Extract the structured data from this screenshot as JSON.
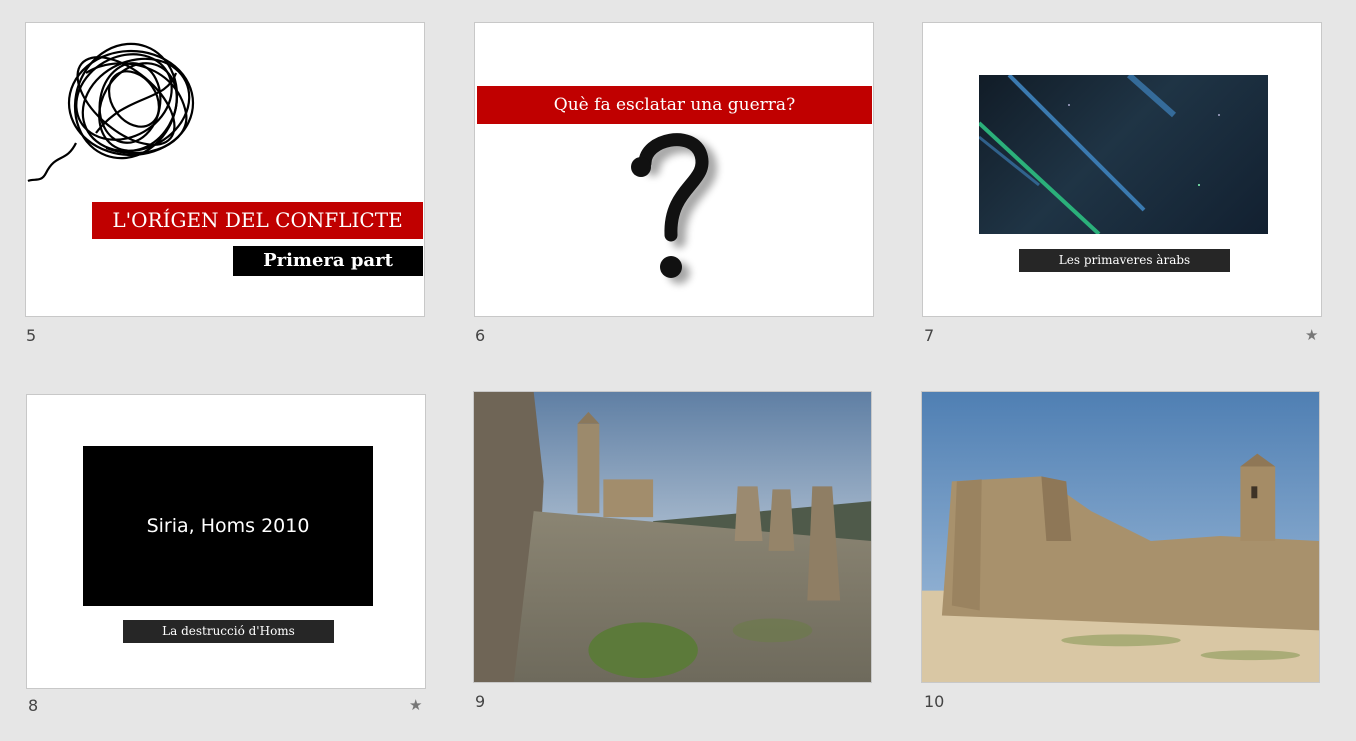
{
  "slides": [
    {
      "number": "5",
      "title": "L'ORÍGEN DEL CONFLICTE",
      "subtitle": "Primera part",
      "has_animation": false
    },
    {
      "number": "6",
      "title": "Què fa esclatar una guerra?",
      "has_animation": false
    },
    {
      "number": "7",
      "caption": "Les primaveres àrabs",
      "has_animation": true
    },
    {
      "number": "8",
      "video_text": "Siria, Homs 2010",
      "caption": "La destrucció d'Homs",
      "has_animation": true
    },
    {
      "number": "9",
      "has_animation": false
    },
    {
      "number": "10",
      "has_animation": false
    }
  ],
  "icons": {
    "animation_star": "★"
  },
  "colors": {
    "accent_red": "#c00000",
    "background": "#e6e6e6"
  }
}
